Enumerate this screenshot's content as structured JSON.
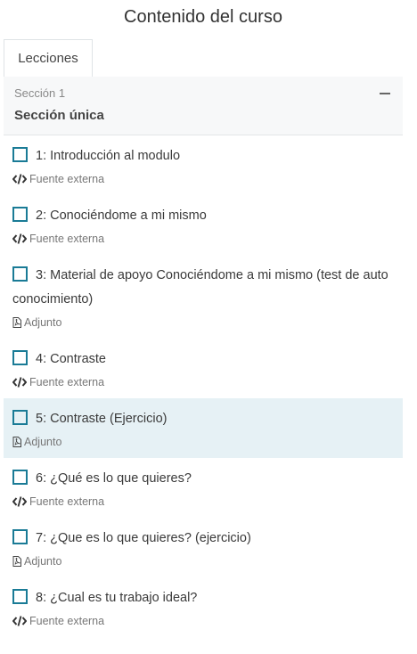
{
  "page_title": "Contenido del curso",
  "tabs": [
    {
      "label": "Lecciones"
    }
  ],
  "section": {
    "subtitle": "Sección 1",
    "title": "Sección única"
  },
  "lessons": [
    {
      "label": "1: Introducción al modulo",
      "type_label": "Fuente externa",
      "type_icon": "code-icon"
    },
    {
      "label": "2: Conociéndome a mi mismo",
      "type_label": "Fuente externa",
      "type_icon": "code-icon"
    },
    {
      "label": "3: Material de apoyo Conociéndome a mi mismo (test de auto conocimiento)",
      "type_label": "Adjunto",
      "type_icon": "pdf-file-icon"
    },
    {
      "label": "4: Contraste",
      "type_label": "Fuente externa",
      "type_icon": "code-icon"
    },
    {
      "label": "5: Contraste (Ejercicio)",
      "type_label": "Adjunto",
      "type_icon": "pdf-file-icon",
      "active": true
    },
    {
      "label": "6: ¿Qué es lo que quieres?",
      "type_label": "Fuente externa",
      "type_icon": "code-icon"
    },
    {
      "label": "7: ¿Que es lo que quieres? (ejercicio)",
      "type_label": "Adjunto",
      "type_icon": "pdf-file-icon"
    },
    {
      "label": "8: ¿Cual es tu trabajo ideal?",
      "type_label": "Fuente externa",
      "type_icon": "code-icon"
    }
  ],
  "colors": {
    "accent": "#1a7b96",
    "active_row": "#e6f1f5"
  }
}
